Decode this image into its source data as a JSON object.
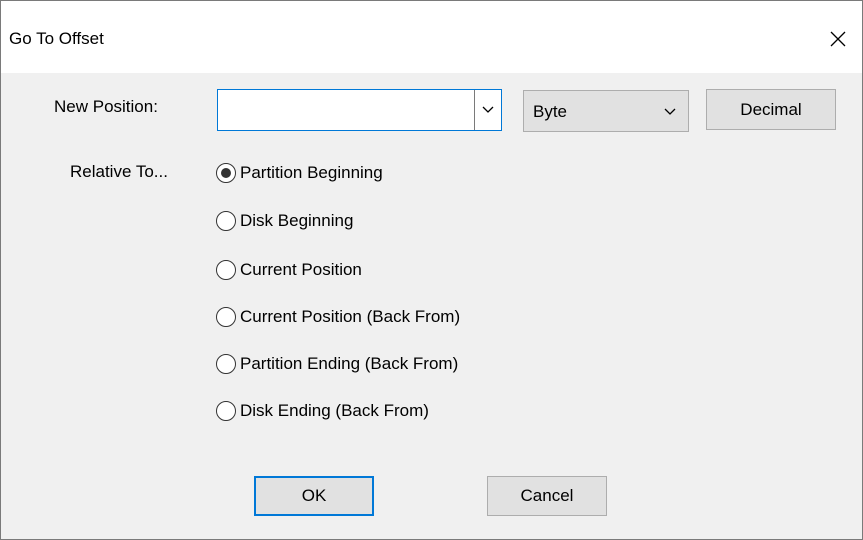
{
  "dialog": {
    "title": "Go To Offset",
    "close_icon": "close-icon"
  },
  "new_position": {
    "label": "New Position:",
    "value": "",
    "placeholder": "",
    "dropdown_icon": "chevron-down-icon"
  },
  "unit_select": {
    "selected": "Byte",
    "dropdown_icon": "chevron-down-icon"
  },
  "base_button": {
    "label": "Decimal"
  },
  "relative_to": {
    "label": "Relative To...",
    "selected_index": 0,
    "options": [
      "Partition Beginning",
      "Disk Beginning",
      "Current Position",
      "Current Position (Back From)",
      "Partition Ending (Back From)",
      "Disk Ending (Back From)"
    ]
  },
  "buttons": {
    "ok": "OK",
    "cancel": "Cancel"
  },
  "colors": {
    "dialog_background": "#f0f0f0",
    "titlebar_background": "#ffffff",
    "focus_accent": "#0078d7",
    "button_face": "#e1e1e1",
    "button_border": "#adadad"
  }
}
